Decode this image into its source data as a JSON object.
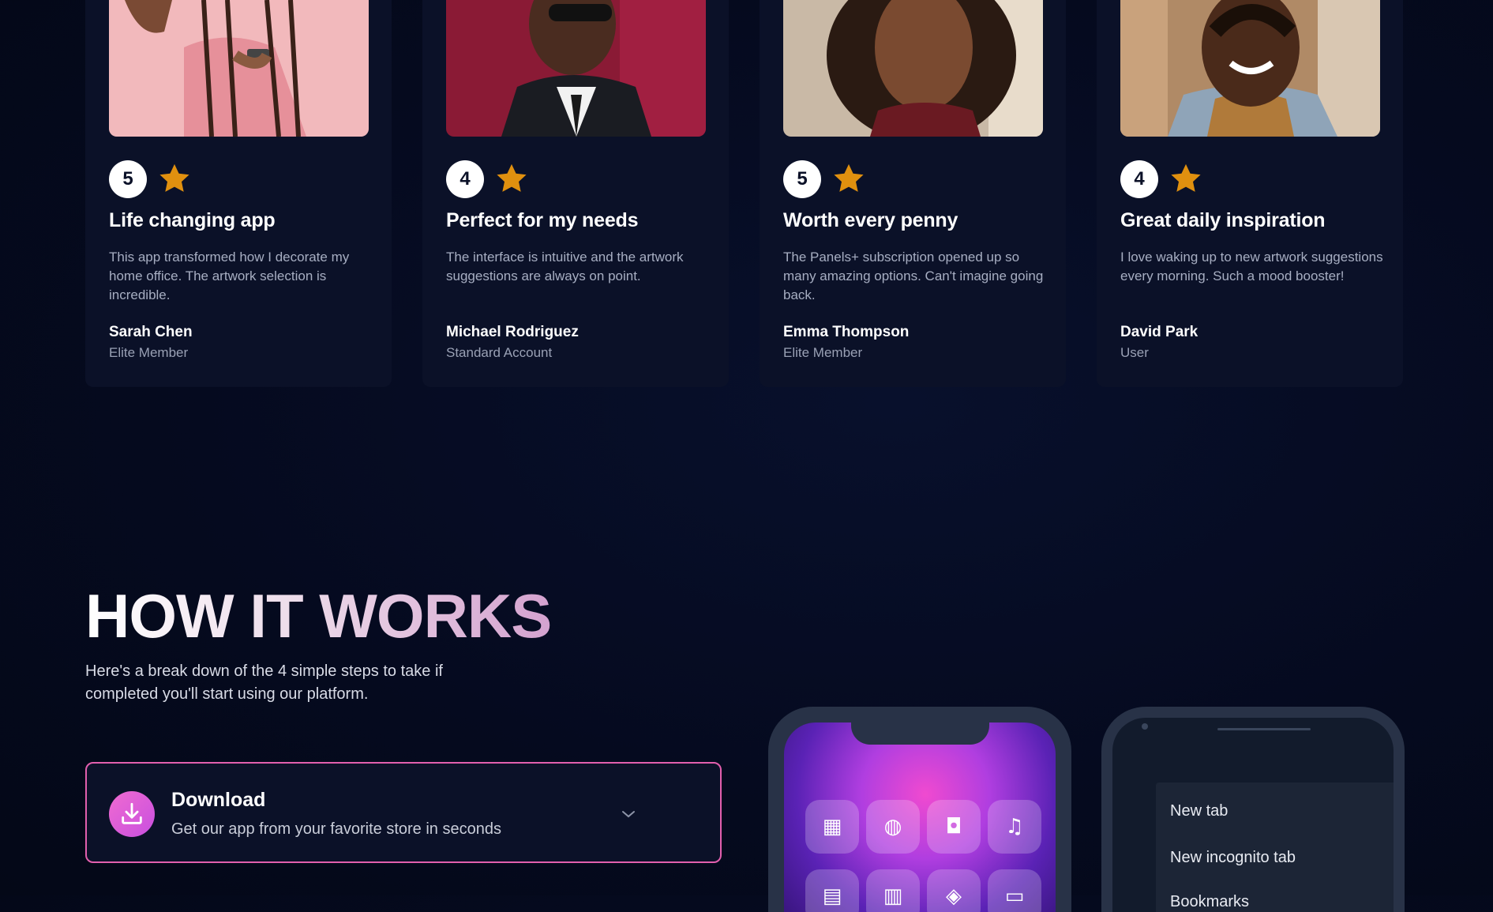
{
  "testimonials": [
    {
      "rating": "5",
      "title": "Life changing app",
      "text": "This app transformed how I decorate my home office. The artwork selection is incredible.",
      "author": "Sarah Chen",
      "role": "Elite Member"
    },
    {
      "rating": "4",
      "title": "Perfect for my needs",
      "text": "The interface is intuitive and the artwork suggestions are always on point.",
      "author": "Michael Rodriguez",
      "role": "Standard Account"
    },
    {
      "rating": "5",
      "title": "Worth every penny",
      "text": "The Panels+ subscription opened up so many amazing options. Can't imagine going back.",
      "author": "Emma Thompson",
      "role": "Elite Member"
    },
    {
      "rating": "4",
      "title": "Great daily inspiration",
      "text": "I love waking up to new artwork suggestions every morning. Such a mood booster!",
      "author": "David Park",
      "role": "User"
    }
  ],
  "how_it_works": {
    "title": "HOW IT WORKS",
    "subtitle": "Here's a break down of the 4 simple steps to take if completed you'll start using our platform.",
    "steps": [
      {
        "title": "Download",
        "description": "Get our app from your favorite store in seconds",
        "icon": "download-icon"
      }
    ]
  },
  "phone_menu": {
    "items": [
      "New tab",
      "New incognito tab",
      "Bookmarks"
    ]
  },
  "colors": {
    "background": "#050a1f",
    "card": "#0b1128",
    "accent_pink": "#e25fae",
    "star": "#e0900f"
  }
}
